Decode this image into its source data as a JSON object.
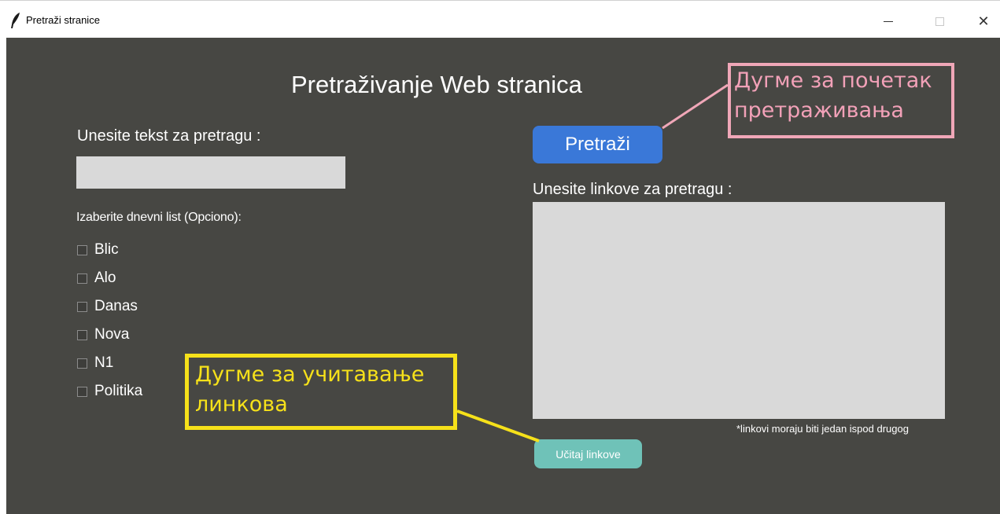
{
  "window": {
    "title": "Pretraži stranice",
    "icon": "feather-icon",
    "buttons": [
      "minimize-icon",
      "maximize-icon",
      "close-icon"
    ],
    "close_glyph": "✕"
  },
  "main": {
    "title": "Pretraživanje Web stranica",
    "search_label": "Unesite tekst za pretragu :",
    "search_value": "",
    "paper_label": "Izaberite dnevni list (Opciono):",
    "papers": [
      {
        "label": "Blic",
        "checked": false
      },
      {
        "label": "Alo",
        "checked": false
      },
      {
        "label": "Danas",
        "checked": false
      },
      {
        "label": "Nova",
        "checked": false
      },
      {
        "label": "N1",
        "checked": false
      },
      {
        "label": "Politika",
        "checked": false
      }
    ],
    "search_button": "Pretraži",
    "links_label": "Unesite linkove za pretragu :",
    "links_value": "",
    "links_note": "*linkovi moraju biti jedan ispod drugog",
    "load_button": "Učitaj linkove"
  },
  "annotations": {
    "search_button_note": {
      "line1": "Дугме за почетак",
      "line2": "претраживања",
      "color": "#f0a7b8"
    },
    "load_button_note": {
      "line1": "Дугме за учитавање",
      "line2": "линкова",
      "color": "#f6e11a"
    }
  },
  "colors": {
    "background": "#474743",
    "input_bg": "#d9d9d9",
    "search_button": "#3a78d8",
    "load_button": "#6fc2b8"
  }
}
